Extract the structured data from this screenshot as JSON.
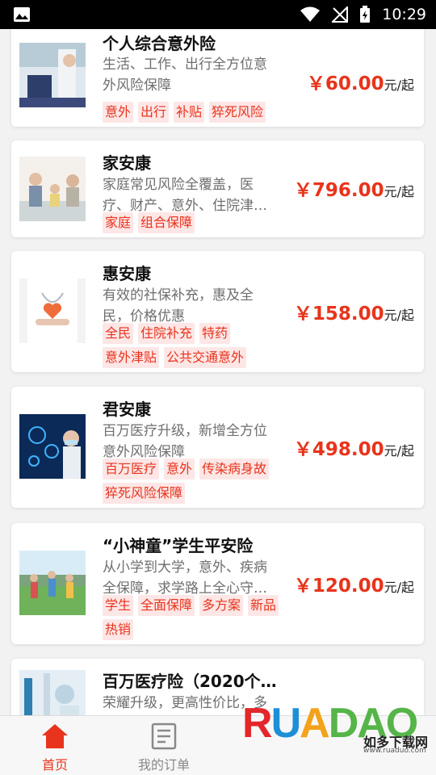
{
  "status_bar": {
    "time": "10:29"
  },
  "products": [
    {
      "title": "个人综合意外险",
      "desc": "生活、工作、出行全方位意外风险保障",
      "tags": [
        "意外",
        "出行",
        "补贴",
        "猝死风险"
      ],
      "price": "￥60.00",
      "unit": "元/起",
      "image_icon": "worker-photo"
    },
    {
      "title": "家安康",
      "desc": "家庭常见风险全覆盖，医疗、财产、意外、住院津…",
      "tags": [
        "家庭",
        "组合保障"
      ],
      "price": "￥796.00",
      "unit": "元/起",
      "image_icon": "family-photo"
    },
    {
      "title": "惠安康",
      "desc": "有效的社保补充，惠及全民，价格优惠",
      "tags": [
        "全民",
        "住院补充",
        "特药",
        "意外津贴",
        "公共交通意外"
      ],
      "price": "￥158.00",
      "unit": "元/起",
      "image_icon": "doctor-heart-photo"
    },
    {
      "title": "君安康",
      "desc": "百万医疗升级，新增全方位意外风险保障",
      "tags": [
        "百万医疗",
        "意外",
        "传染病身故",
        "猝死风险保障"
      ],
      "price": "￥498.00",
      "unit": "元/起",
      "image_icon": "medical-tech-photo"
    },
    {
      "title": "“小神童”学生平安险",
      "desc": "从小学到大学，意外、疾病全保障，求学路上全心守…",
      "tags": [
        "学生",
        "全面保障",
        "多方案",
        "新品",
        "热销"
      ],
      "price": "￥120.00",
      "unit": "元/起",
      "image_icon": "students-photo"
    },
    {
      "title": "百万医疗险（2020个…",
      "desc": "荣耀升级，更高性价比，多重选附加保障",
      "tags": [],
      "price": "",
      "unit": "",
      "image_icon": "lab-photo"
    }
  ],
  "bottom_nav": {
    "home": {
      "label": "首页",
      "icon": "home-icon"
    },
    "orders": {
      "label": "我的订单",
      "icon": "orders-icon"
    }
  },
  "watermark": {
    "logo": "RUANDAO",
    "cn": "如多下载网",
    "url": "www.ruaduo.com"
  },
  "colors": {
    "accent": "#e8341c",
    "tag_bg": "#fde6e6"
  }
}
